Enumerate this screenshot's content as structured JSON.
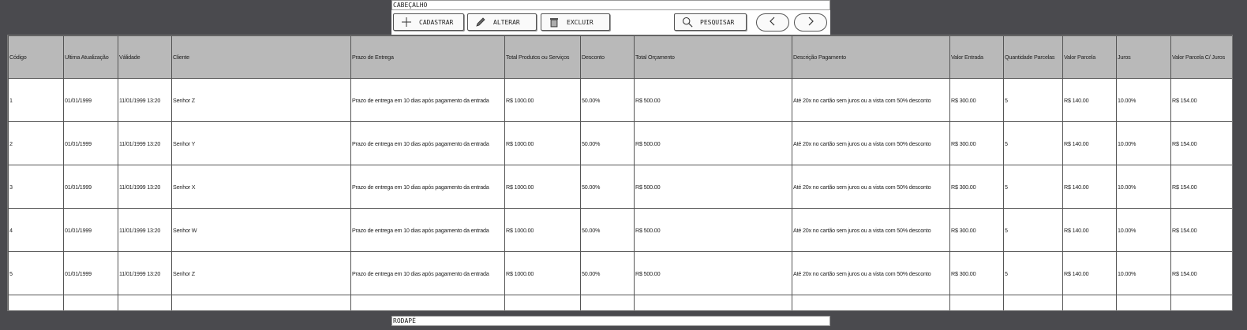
{
  "header": {
    "label": "CABEÇALHO"
  },
  "toolbar": {
    "cadastrar_label": "CADASTRAR",
    "alterar_label": "ALTERAR",
    "excluir_label": "EXCLUIR",
    "pesquisar_label": "PESQUISAR",
    "icons": [
      "plus-icon",
      "pencil-icon",
      "trash-icon",
      "search-icon",
      "chevron-left-icon",
      "chevron-right-icon"
    ]
  },
  "table": {
    "columns": [
      "Código",
      "Ultima Atualização",
      "Válidade",
      "Cliente",
      "Prazo de Entrega",
      "Total Produtos ou Serviços",
      "Desconto",
      "Total Orçamento",
      "Descrição Pagamento",
      "Valor Entrada",
      "Quantidade Parcelas",
      "Valor Parcela",
      "Juros",
      "Valor Parcela C/ Juros"
    ],
    "rows": [
      [
        "1",
        "01/01/1999",
        "11/01/1999 13:20",
        "Senhor Z",
        "Prazo de entrega em 10 dias após pagamento da entrada",
        "R$ 1000.00",
        "50.00%",
        "R$ 500.00",
        "Até 20x no cartão sem juros ou a vista com 50% desconto",
        "R$ 300.00",
        "5",
        "R$ 140.00",
        "10.00%",
        "R$ 154.00"
      ],
      [
        "2",
        "01/01/1999",
        "11/01/1999 13:20",
        "Senhor Y",
        "Prazo de entrega em 10 dias após pagamento da entrada",
        "R$ 1000.00",
        "50.00%",
        "R$ 500.00",
        "Até 20x no cartão sem juros ou a vista com 50% desconto",
        "R$ 300.00",
        "5",
        "R$ 140.00",
        "10.00%",
        "R$ 154.00"
      ],
      [
        "3",
        "01/01/1999",
        "11/01/1999 13:20",
        "Senhor X",
        "Prazo de entrega em 10 dias após pagamento da entrada",
        "R$ 1000.00",
        "50.00%",
        "R$ 500.00",
        "Até 20x no cartão sem juros ou a vista com 50% desconto",
        "R$ 300.00",
        "5",
        "R$ 140.00",
        "10.00%",
        "R$ 154.00"
      ],
      [
        "4",
        "01/01/1999",
        "11/01/1999 13:20",
        "Senhor W",
        "Prazo de entrega em 10 dias após pagamento da entrada",
        "R$ 1000.00",
        "50.00%",
        "R$ 500.00",
        "Até 20x no cartão sem juros ou a vista com 50% desconto",
        "R$ 300.00",
        "5",
        "R$ 140.00",
        "10.00%",
        "R$ 154.00"
      ],
      [
        "5",
        "01/01/1999",
        "11/01/1999 13:20",
        "Senhor Z",
        "Prazo de entrega em 10 dias após pagamento da entrada",
        "R$ 1000.00",
        "50.00%",
        "R$ 500.00",
        "Até 20x no cartão sem juros ou a vista com 50% desconto",
        "R$ 300.00",
        "5",
        "R$ 140.00",
        "10.00%",
        "R$ 154.00"
      ],
      [
        "",
        "",
        "",
        "",
        "",
        "",
        "",
        "",
        "",
        "",
        "",
        "",
        "",
        ""
      ]
    ]
  },
  "footer": {
    "label": "RODAPÉ"
  },
  "colors": {
    "background": "#4a4a4e",
    "header_row": "#b9b9b9",
    "panel": "#ffffff"
  }
}
